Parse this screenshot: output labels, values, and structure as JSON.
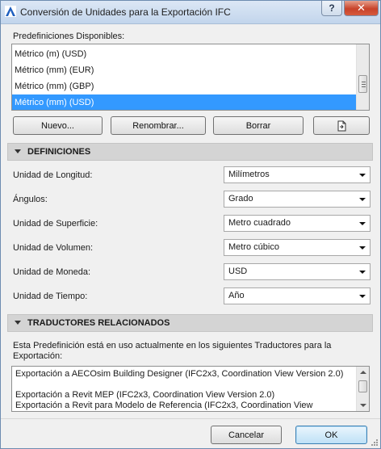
{
  "window": {
    "title": "Conversión de Unidades para la Exportación IFC",
    "help_label": "?",
    "close_label": "✕"
  },
  "presets": {
    "label": "Predefiniciones Disponibles:",
    "items": [
      {
        "label": "Métrico (m) (USD)",
        "selected": false
      },
      {
        "label": "Métrico (mm) (EUR)",
        "selected": false
      },
      {
        "label": "Métrico (mm) (GBP)",
        "selected": false
      },
      {
        "label": "Métrico (mm) (USD)",
        "selected": true
      }
    ],
    "buttons": {
      "new": "Nuevo...",
      "rename": "Renombrar...",
      "delete": "Borrar",
      "import_icon": "import-document-icon"
    }
  },
  "definitions": {
    "header": "DEFINICIONES",
    "fields": [
      {
        "label": "Unidad de Longitud:",
        "value": "Milímetros"
      },
      {
        "label": "Ángulos:",
        "value": "Grado"
      },
      {
        "label": "Unidad de Superficie:",
        "value": "Metro cuadrado"
      },
      {
        "label": "Unidad de Volumen:",
        "value": "Metro cúbico"
      },
      {
        "label": "Unidad de Moneda:",
        "value": "USD"
      },
      {
        "label": "Unidad de Tiempo:",
        "value": "Año"
      }
    ]
  },
  "translators": {
    "header": "TRADUCTORES RELACIONADOS",
    "description": "Esta Predefinición está en uso actualmente en los siguientes Traductores para la Exportación:",
    "items": [
      "Exportación a AECOsim Building Designer (IFC2x3, Coordination View Version 2.0)",
      "Exportación a Revit MEP (IFC2x3, Coordination View Version 2.0)",
      "Exportación a Revit para Modelo de Referencia (IFC2x3, Coordination View"
    ]
  },
  "footer": {
    "cancel": "Cancelar",
    "ok": "OK"
  },
  "colors": {
    "selection": "#3399ff",
    "section_header": "#d4d4d4",
    "close_button": "#c8432a"
  }
}
